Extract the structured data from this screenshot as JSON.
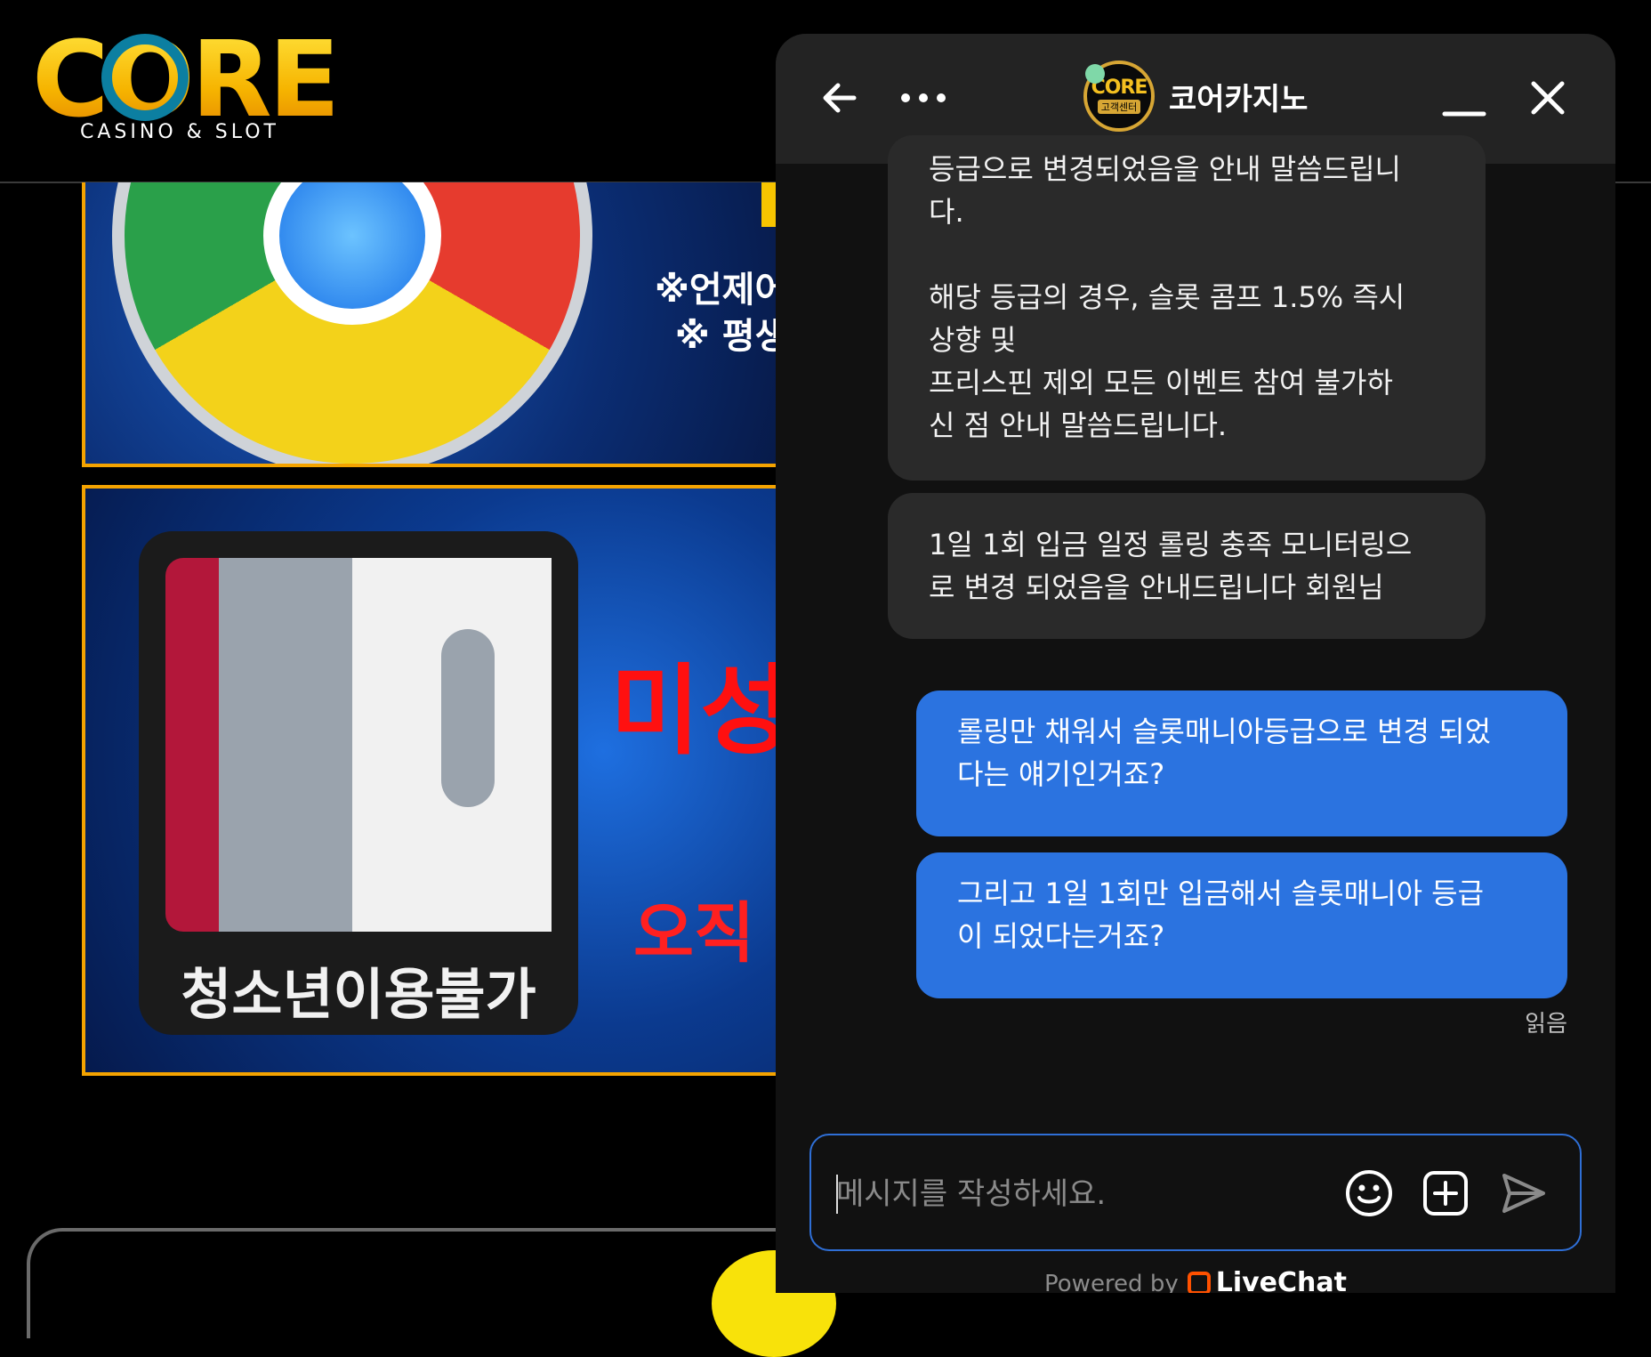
{
  "site": {
    "logo_word": "CORE",
    "logo_sub": "CASINO & SLOT",
    "banner1_text": "※언제어디\n※ 평생도\n사",
    "banner2_warn": "미성",
    "banner2_warn2": "오직",
    "age_badge_label": "청소년이용불가"
  },
  "chat": {
    "header": {
      "back_icon": "arrow-left-icon",
      "more_icon": "more-horizontal-icon",
      "agent_avatar_word": "CORE",
      "agent_avatar_sub": "고객센터",
      "agent_name": "코어카지노",
      "minimize_icon": "minimize-icon",
      "close_icon": "close-icon"
    },
    "messages": [
      {
        "from": "agent",
        "text": "등급으로 변경되었음을 안내 말씀드립니\n다.\n\n해당 등급의 경우, 슬롯 콤프 1.5% 즉시\n상향 및\n프리스핀 제외 모든 이벤트 참여 불가하\n신 점 안내 말씀드립니다."
      },
      {
        "from": "agent",
        "text": "1일 1회 입금 일정 롤링 충족 모니터링으\n로 변경 되었음을 안내드립니다 회원님"
      },
      {
        "from": "user",
        "text": "롤링만 채워서 슬롯매니아등급으로 변경 되었\n다는 얘기인거죠?"
      },
      {
        "from": "user",
        "text": "그리고 1일 1회만 입금해서 슬롯매니아 등급\n이 되었다는거죠?"
      }
    ],
    "read_receipt": "읽음",
    "composer": {
      "placeholder": "메시지를 작성하세요.",
      "emoji_icon": "emoji-icon",
      "attach_icon": "add-attachment-icon",
      "send_icon": "send-icon"
    },
    "powered_by": "Powered by",
    "powered_brand": "LiveChat"
  },
  "colors": {
    "user_bubble": "#2b73e0",
    "agent_bubble": "#2a2a2a",
    "header_bg": "#232323",
    "panel_bg": "#111111",
    "online": "#7fd8a8",
    "brand_gold": "#f6b400"
  }
}
